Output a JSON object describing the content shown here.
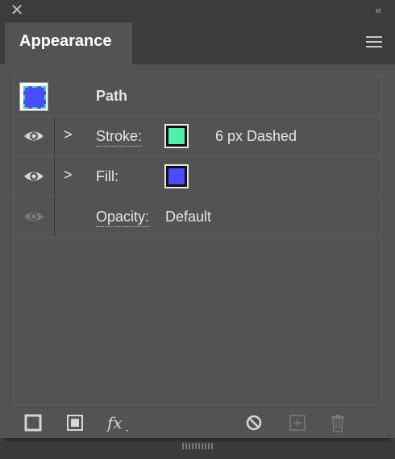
{
  "panel": {
    "title": "Appearance"
  },
  "rows": {
    "path": {
      "label": "Path"
    },
    "stroke": {
      "label": "Stroke:",
      "value": "6 px Dashed",
      "color": "#4ff0a8"
    },
    "fill": {
      "label": "Fill:",
      "color": "#4a4cff"
    },
    "opacity": {
      "label": "Opacity:",
      "value": "Default"
    }
  },
  "colors": {
    "panel_bg": "#535353",
    "header_bg": "#3c3c3c",
    "stroke_swatch": "#4ff0a8",
    "fill_swatch": "#4a4cff"
  }
}
